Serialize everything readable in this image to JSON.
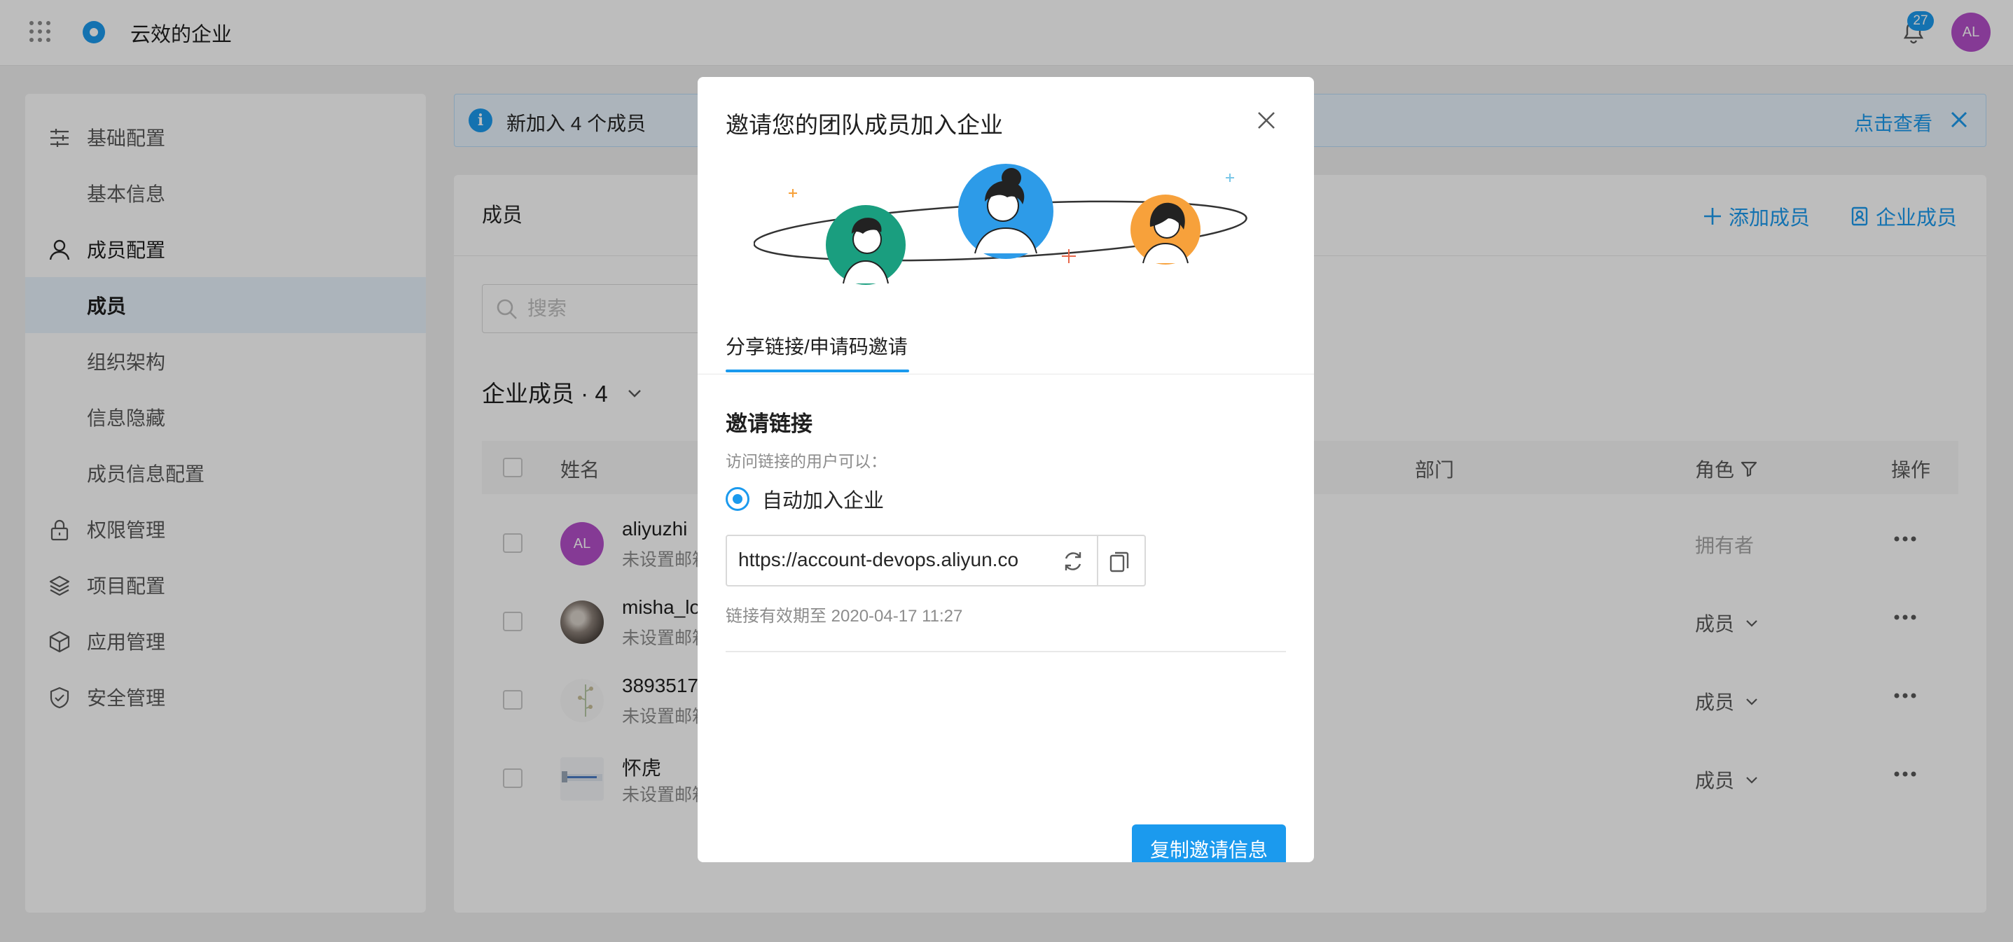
{
  "topbar": {
    "org_name": "云效的企业",
    "notification_count": "27",
    "avatar_initials": "AL"
  },
  "sidebar": {
    "items": [
      {
        "label": "基础配置",
        "icon": "sliders-icon",
        "type": "group"
      },
      {
        "label": "基本信息",
        "type": "sub"
      },
      {
        "label": "成员配置",
        "icon": "user-icon",
        "type": "group"
      },
      {
        "label": "成员",
        "type": "sub",
        "active": true
      },
      {
        "label": "组织架构",
        "type": "sub"
      },
      {
        "label": "信息隐藏",
        "type": "sub"
      },
      {
        "label": "成员信息配置",
        "type": "sub"
      },
      {
        "label": "权限管理",
        "icon": "lock-icon",
        "type": "group"
      },
      {
        "label": "项目配置",
        "icon": "layers-icon",
        "type": "group"
      },
      {
        "label": "应用管理",
        "icon": "cube-icon",
        "type": "group"
      },
      {
        "label": "安全管理",
        "icon": "shield-icon",
        "type": "group"
      }
    ]
  },
  "banner": {
    "text": "新加入 4 个成员",
    "link": "点击查看"
  },
  "members_panel": {
    "title": "成员",
    "add_member_label": "添加成员",
    "enterprise_member_label": "企业成员",
    "search_placeholder": "搜索",
    "count_title": "企业成员 · 4",
    "columns": {
      "name": "姓名",
      "department": "部门",
      "role": "角色",
      "actions": "操作"
    },
    "rows": [
      {
        "name": "aliyuzhi",
        "email": "未设置邮箱",
        "role": "拥有者",
        "role_editable": false,
        "avatar": "AL"
      },
      {
        "name": "misha_lo",
        "email": "未设置邮箱",
        "role": "成员",
        "role_editable": true,
        "avatar": ""
      },
      {
        "name": "3893517",
        "email": "未设置邮箱",
        "role": "成员",
        "role_editable": true,
        "avatar": ""
      },
      {
        "name": "怀虎",
        "email": "未设置邮箱",
        "role": "成员",
        "role_editable": true,
        "avatar": ""
      }
    ]
  },
  "invite_modal": {
    "title": "邀请您的团队成员加入企业",
    "tab": "分享链接/申请码邀请",
    "section_title": "邀请链接",
    "section_desc": "访问链接的用户可以：",
    "option_label": "自动加入企业",
    "link_value": "https://account-devops.aliyun.co",
    "expire_text": "链接有效期至 2020-04-17 11:27",
    "copy_button": "复制邀请信息"
  },
  "colors": {
    "accent": "#1b9aee",
    "avatar_purple": "#b44fc9",
    "illustration_green": "#1a9e7f",
    "illustration_orange": "#f7a13b"
  }
}
